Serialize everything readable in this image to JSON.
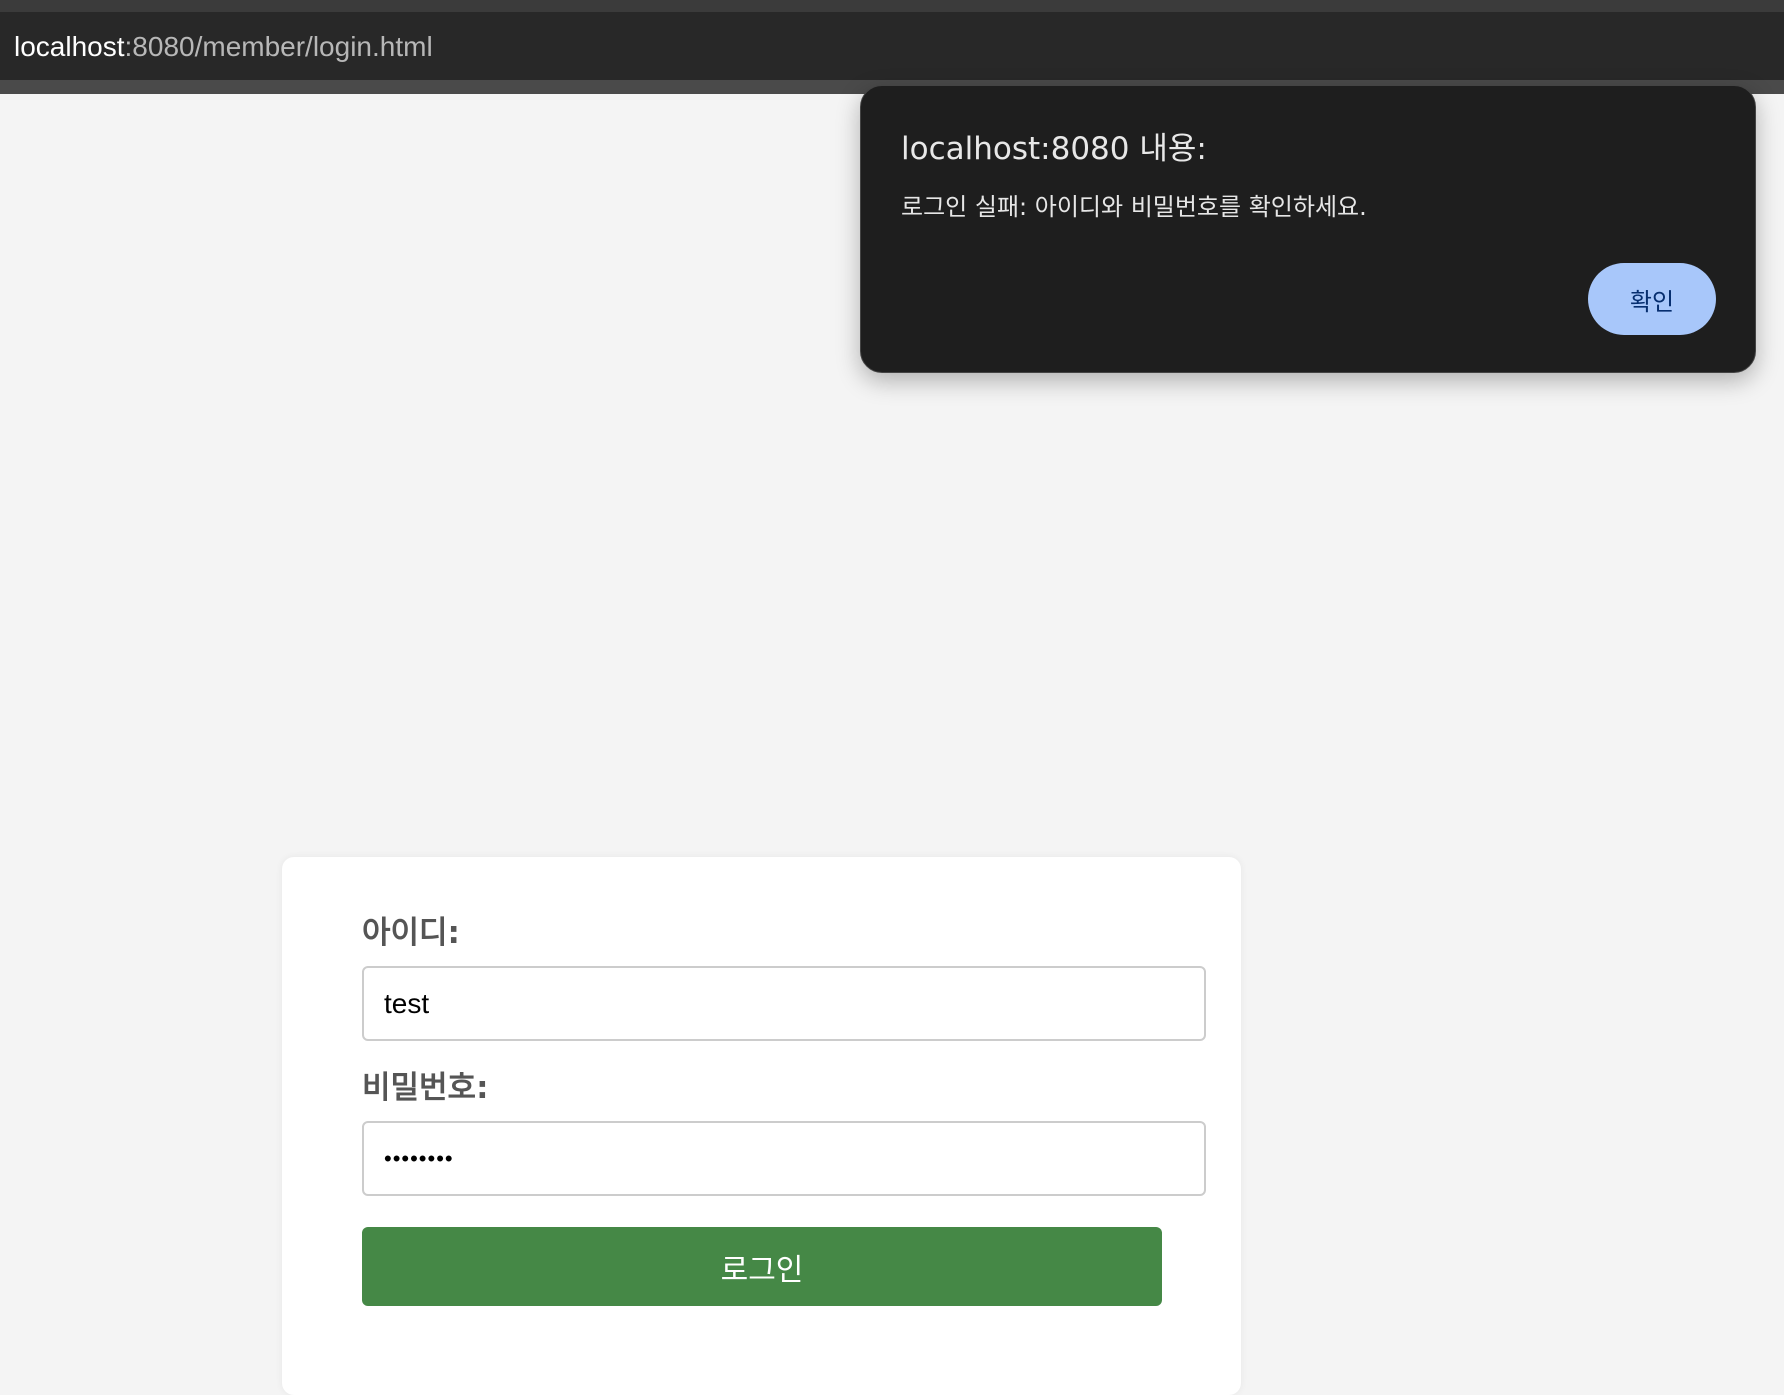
{
  "browser": {
    "url_host": "localhost",
    "url_path": ":8080/member/login.html"
  },
  "login_form": {
    "id_label": "아이디:",
    "id_value": "test",
    "password_label": "비밀번호:",
    "password_value": "••••••••",
    "submit_label": "로그인",
    "submit_color": "#458846"
  },
  "alert": {
    "title": "localhost:8080 내용:",
    "message": "로그인 실패: 아이디와 비밀번호를 확인하세요.",
    "ok_label": "확인",
    "ok_color": "#a8c7fa"
  }
}
